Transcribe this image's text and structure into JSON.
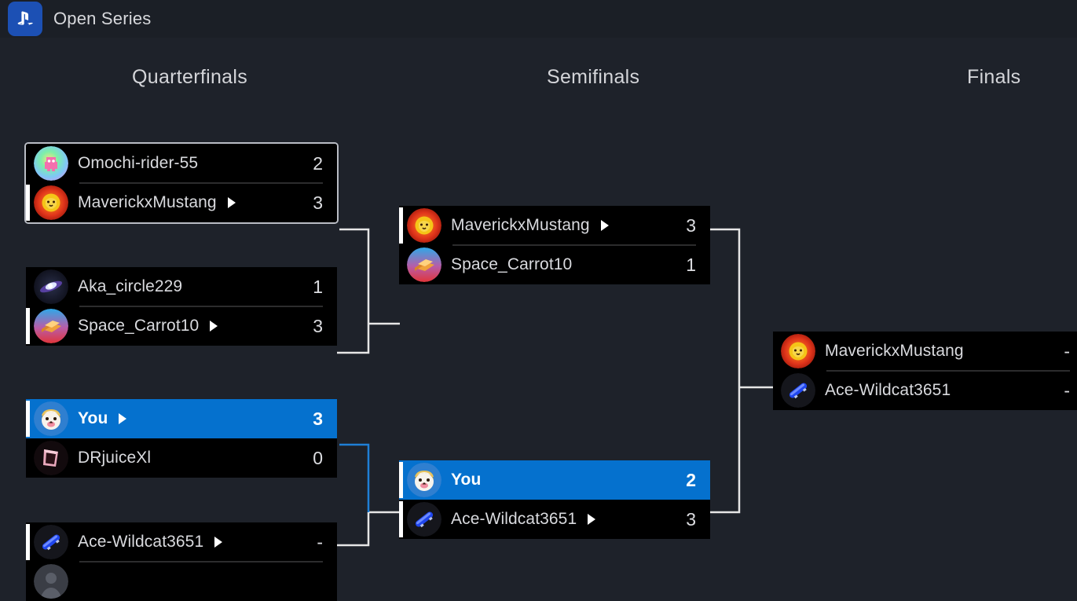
{
  "header": {
    "logo_icon": "playstation-logo-icon",
    "title": "Open Series"
  },
  "rounds": [
    {
      "label": "Quarterfinals"
    },
    {
      "label": "Semifinals"
    },
    {
      "label": "Finals"
    }
  ],
  "colors": {
    "background": "#1e222a",
    "card": "#000000",
    "highlight_blue": "#0571ce",
    "focus_border": "#b9bcc4",
    "connector": "#e6e6e6",
    "connector_active": "#1f7fd6",
    "text": "#d9dade"
  },
  "matches": {
    "qf1": {
      "top": {
        "name": "Omochi-rider-55",
        "score": "2",
        "avatar": "rainbow-creature-avatar",
        "winner": false,
        "you": false
      },
      "bottom": {
        "name": "MaverickxMustang",
        "score": "3",
        "avatar": "lion-avatar",
        "winner": true,
        "you": false
      }
    },
    "qf2": {
      "top": {
        "name": "Aka_circle229",
        "score": "1",
        "avatar": "galaxy-avatar",
        "winner": false,
        "you": false
      },
      "bottom": {
        "name": "Space_Carrot10",
        "score": "3",
        "avatar": "carrot-cake-avatar",
        "winner": true,
        "you": false
      }
    },
    "qf3": {
      "top": {
        "name": "You",
        "score": "3",
        "avatar": "cheetah-avatar",
        "winner": true,
        "you": true
      },
      "bottom": {
        "name": "DRjuiceXl",
        "score": "0",
        "avatar": "pink-gem-avatar",
        "winner": false,
        "you": false
      }
    },
    "qf4": {
      "top": {
        "name": "Ace-Wildcat3651",
        "score": "-",
        "avatar": "skateboard-avatar",
        "winner": true,
        "you": false
      },
      "bottom": {
        "name": "",
        "score": "",
        "avatar": "unknown-avatar",
        "winner": false,
        "you": false
      }
    },
    "sf1": {
      "top": {
        "name": "MaverickxMustang",
        "score": "3",
        "avatar": "lion-avatar",
        "winner": true,
        "you": false
      },
      "bottom": {
        "name": "Space_Carrot10",
        "score": "1",
        "avatar": "carrot-cake-avatar",
        "winner": false,
        "you": false
      }
    },
    "sf2": {
      "top": {
        "name": "You",
        "score": "2",
        "avatar": "cheetah-avatar",
        "winner": false,
        "you": true
      },
      "bottom": {
        "name": "Ace-Wildcat3651",
        "score": "3",
        "avatar": "skateboard-avatar",
        "winner": true,
        "you": false
      }
    },
    "final": {
      "top": {
        "name": "MaverickxMustang",
        "score": "-",
        "avatar": "lion-avatar",
        "winner": false,
        "you": false
      },
      "bottom": {
        "name": "Ace-Wildcat3651",
        "score": "-",
        "avatar": "skateboard-avatar",
        "winner": false,
        "you": false
      }
    }
  }
}
